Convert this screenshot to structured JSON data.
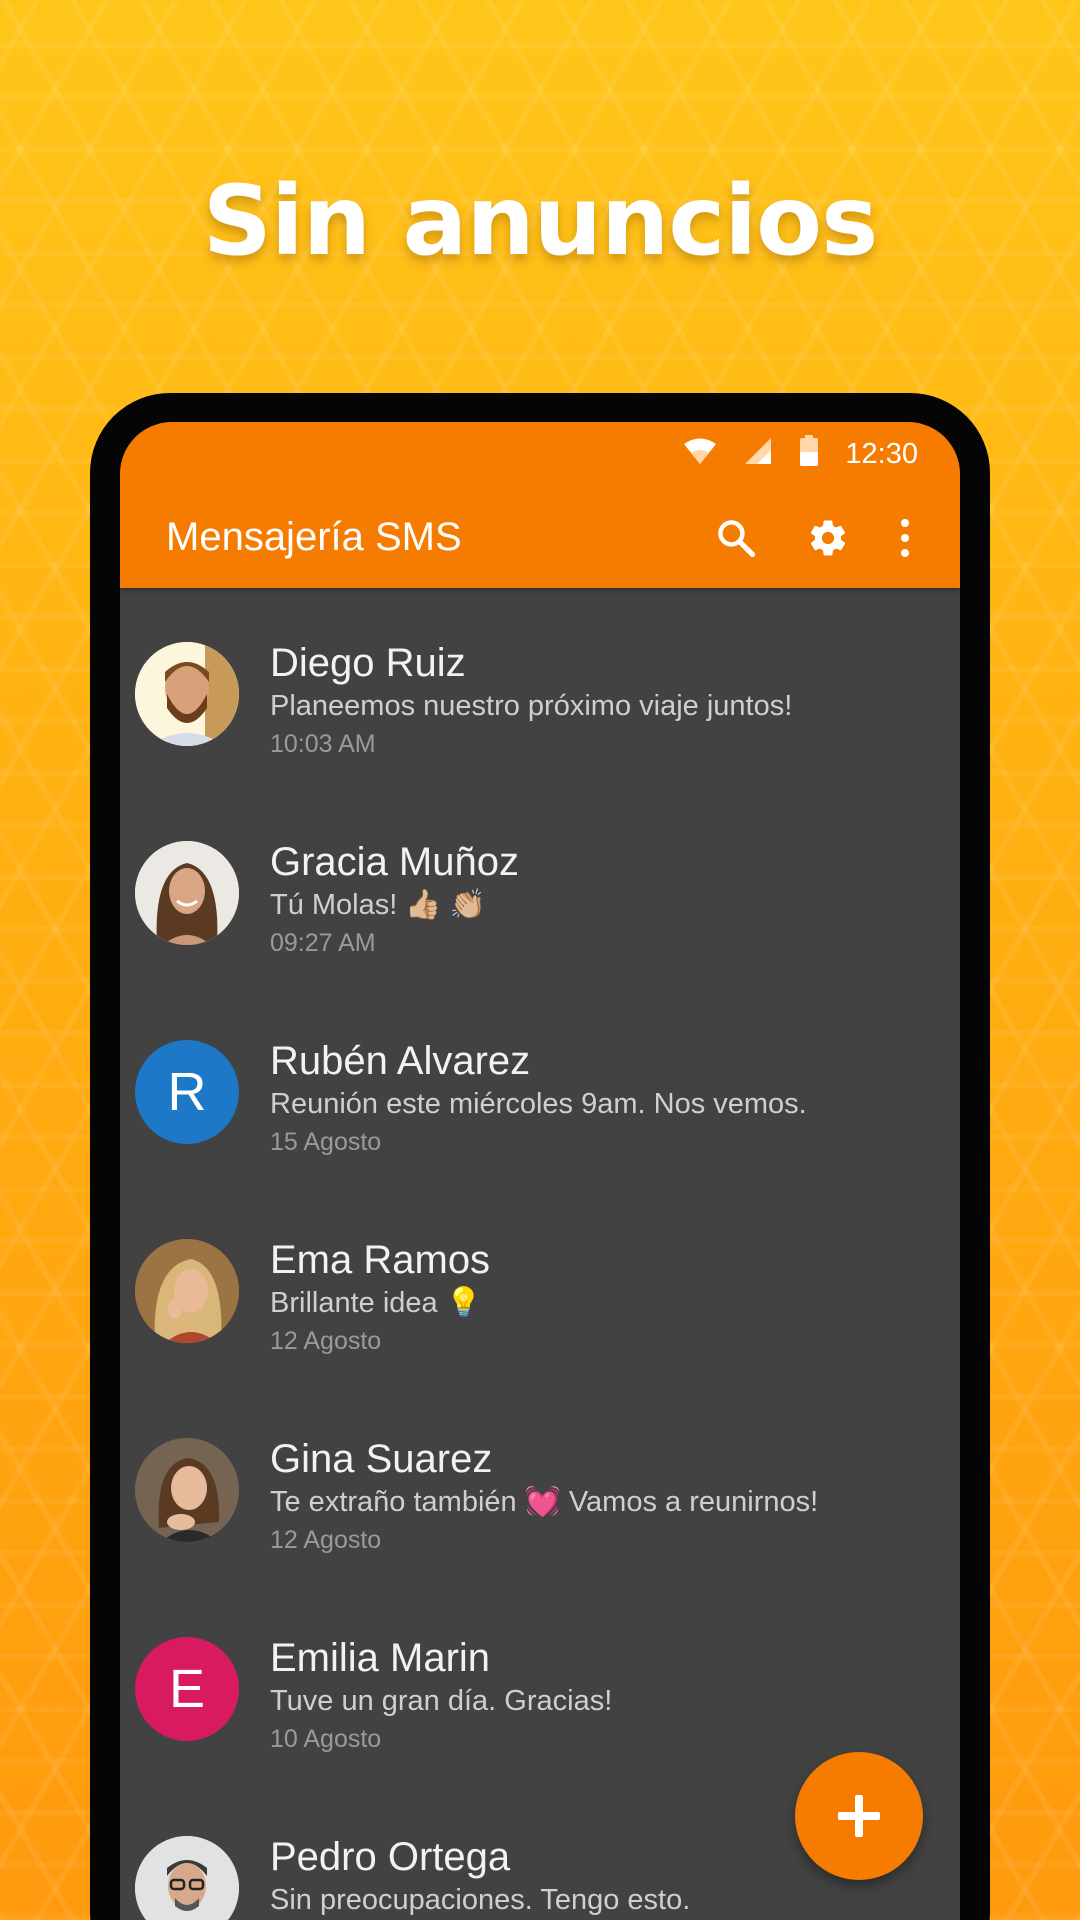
{
  "headline": "Sin anuncios",
  "status_bar": {
    "time": "12:30"
  },
  "app_bar": {
    "title": "Mensajería SMS"
  },
  "colors": {
    "accent": "#f57c00",
    "list_background": "#424242",
    "avatar_blue": "#1e78c8",
    "avatar_pink": "#d81b60"
  },
  "conversations": [
    {
      "name": "Diego Ruiz",
      "message": "Planeemos nuestro próximo viaje juntos!",
      "time": "10:03 AM",
      "avatar": "photo"
    },
    {
      "name": "Gracia Muñoz",
      "message": "Tú Molas! 👍🏼 👏🏼",
      "time": "09:27 AM",
      "avatar": "photo"
    },
    {
      "name": "Rubén Alvarez",
      "message": "Reunión este miércoles 9am. Nos vemos.",
      "time": "15 Agosto",
      "avatar_letter": "R"
    },
    {
      "name": "Ema Ramos",
      "message": "Brillante idea 💡",
      "time": "12 Agosto",
      "avatar": "photo"
    },
    {
      "name": "Gina Suarez",
      "message": "Te extraño también 💓 Vamos a reunirnos!",
      "time": "12 Agosto",
      "avatar": "photo"
    },
    {
      "name": "Emilia Marin",
      "message": "Tuve un gran día. Gracias!",
      "time": "10 Agosto",
      "avatar_letter": "E"
    },
    {
      "name": "Pedro Ortega",
      "message": "Sin preocupaciones. Tengo esto.",
      "time": "",
      "avatar": "photo"
    }
  ],
  "icons": [
    "wifi-icon",
    "signal-icon",
    "battery-icon",
    "search-icon",
    "gear-icon",
    "more-vert-icon",
    "plus-icon"
  ]
}
